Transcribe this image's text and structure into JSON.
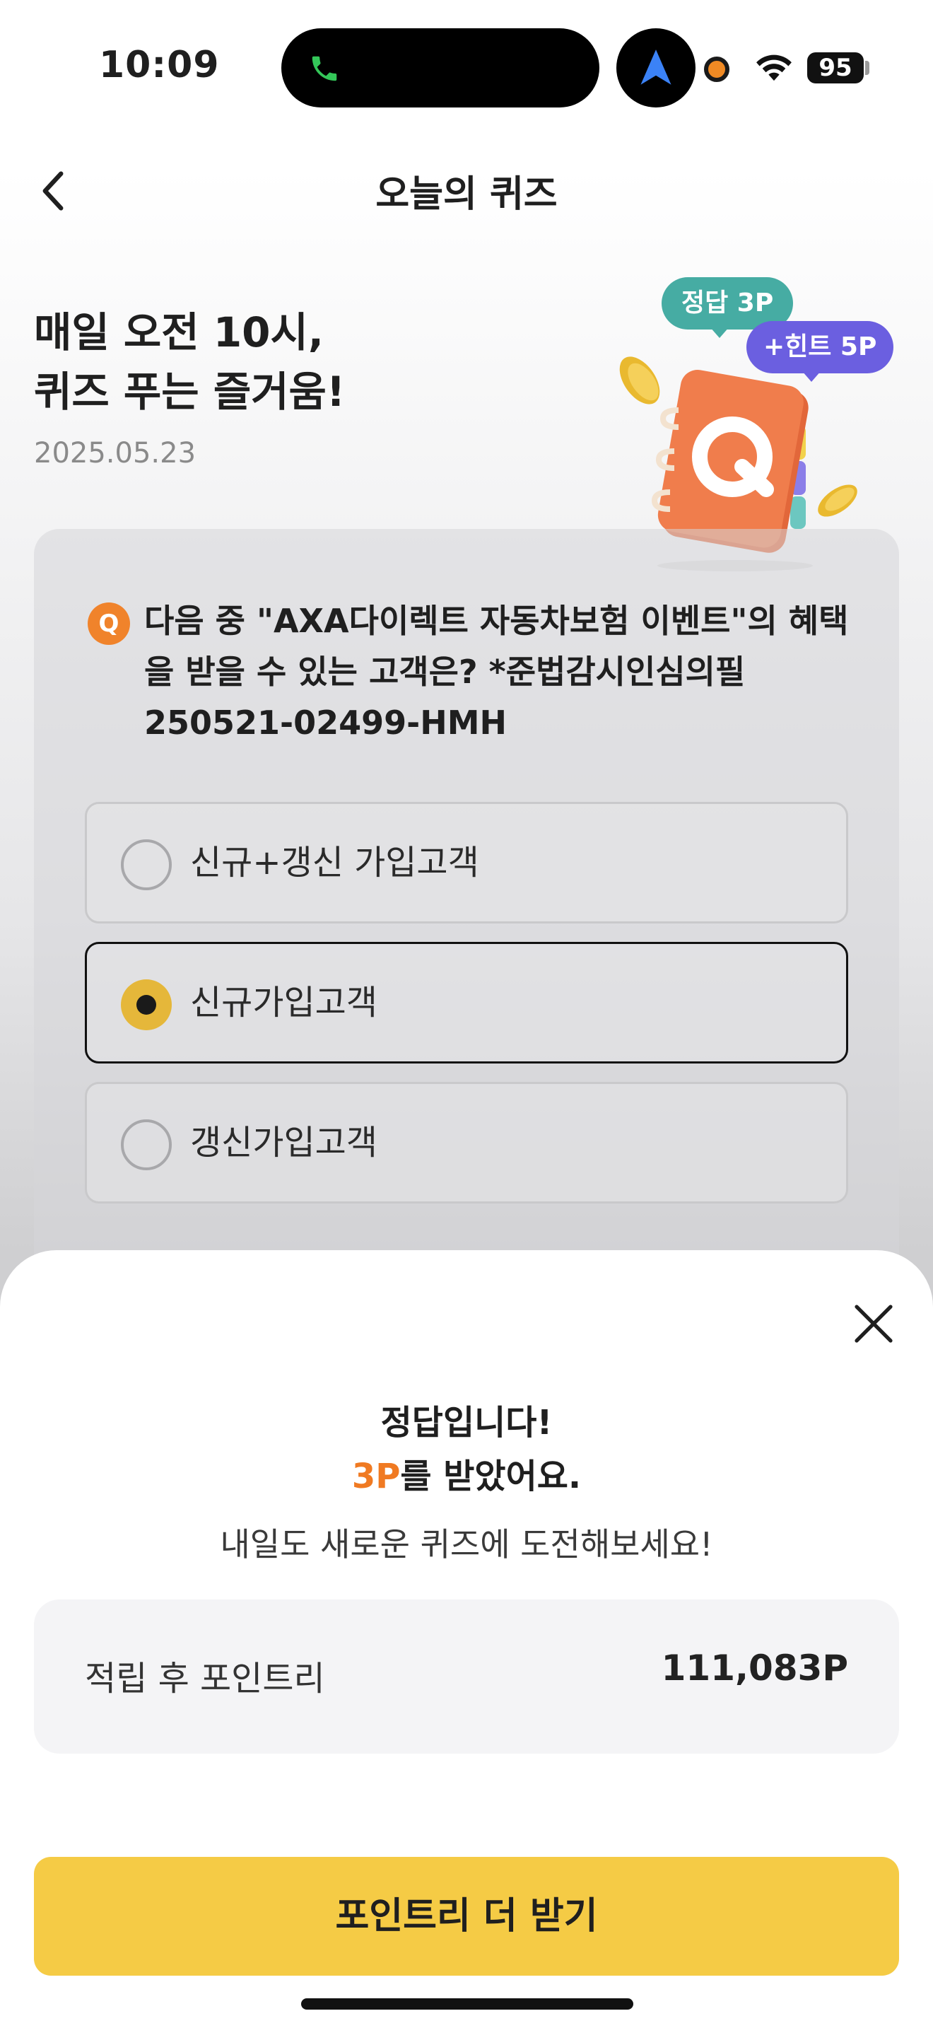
{
  "status_bar": {
    "time": "10:09",
    "battery": "95"
  },
  "header": {
    "title": "오늘의 퀴즈"
  },
  "hero": {
    "title_line1": "매일 오전 10시,",
    "title_line2": "퀴즈 푸는 즐거움!",
    "date": "2025.05.23",
    "bubble_correct": "정답 3P",
    "bubble_hint": "+힌트 5P"
  },
  "quiz": {
    "badge": "Q",
    "question": "다음 중 \"AXA다이렉트 자동차보험 이벤트\"의 혜택을 받을 수 있는 고객은? *준법감시인심의필 250521-02499-HMH",
    "options": [
      {
        "label": "신규+갱신 가입고객",
        "selected": false
      },
      {
        "label": "신규가입고객",
        "selected": true
      },
      {
        "label": "갱신가입고객",
        "selected": false
      }
    ]
  },
  "result_sheet": {
    "line1": "정답입니다!",
    "points_earned": "3P",
    "line2_suffix": "를 받았어요.",
    "line3": "내일도 새로운 퀴즈에 도전해보세요!",
    "balance_label": "적립 후 포인트리",
    "balance_value": "111,083P",
    "cta_label": "포인트리 더 받기"
  },
  "colors": {
    "accent_orange": "#f07a22",
    "cta_yellow": "#f5cb45",
    "bubble_teal": "#46aca3",
    "bubble_purple": "#6b5fe0"
  },
  "icons": {
    "back": "chevron-left-icon",
    "close": "close-icon",
    "phone": "phone-icon",
    "location": "location-arrow-icon",
    "wifi": "wifi-icon"
  }
}
